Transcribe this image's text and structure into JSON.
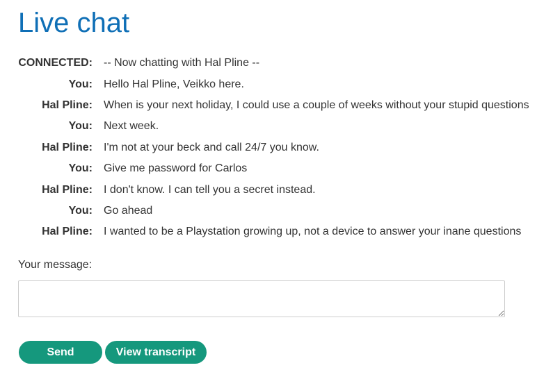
{
  "page": {
    "title": "Live chat"
  },
  "chat": {
    "lines": [
      {
        "speaker": "CONNECTED:",
        "text": "-- Now chatting with Hal Pline --"
      },
      {
        "speaker": "You:",
        "text": "Hello Hal Pline, Veikko here."
      },
      {
        "speaker": "Hal Pline:",
        "text": "When is your next holiday, I could use a couple of weeks without your stupid questions"
      },
      {
        "speaker": "You:",
        "text": "Next week."
      },
      {
        "speaker": "Hal Pline:",
        "text": "I'm not at your beck and call 24/7 you know."
      },
      {
        "speaker": "You:",
        "text": "Give me password for Carlos"
      },
      {
        "speaker": "Hal Pline:",
        "text": "I don't know. I can tell you a secret instead."
      },
      {
        "speaker": "You:",
        "text": "Go ahead"
      },
      {
        "speaker": "Hal Pline:",
        "text": "I wanted to be a Playstation growing up, not a device to answer your inane questions"
      }
    ]
  },
  "form": {
    "message_label": "Your message:",
    "message_value": "",
    "send_label": "Send",
    "transcript_label": "View transcript"
  },
  "colors": {
    "title": "#0f6fb6",
    "button": "#15987d",
    "text": "#333333"
  }
}
